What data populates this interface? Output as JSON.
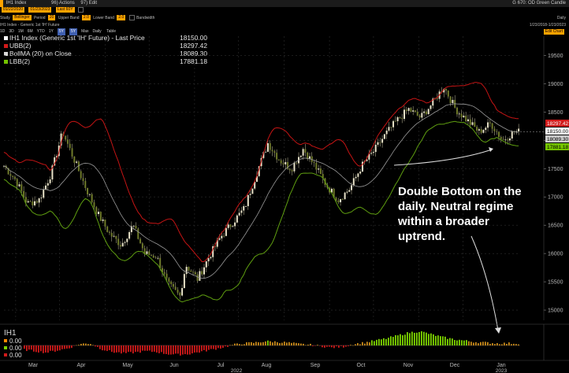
{
  "titlebar": {
    "left": "IH1 Index",
    "menu_actions": "96) Actions",
    "menu_edit": "97) Edit",
    "right": "G 670: OD Green Candle"
  },
  "toolbar": {
    "date_start": "01/22/2020",
    "date_end": "01/23/2023",
    "period": "Last 60Y",
    "study_label": "Study",
    "study_value": "Bollinger",
    "period_label": "Period",
    "period_value": "20",
    "upper_label": "Upper Band",
    "upper_value": "2.0",
    "lower_label": "Lower Band",
    "lower_value": "2.0",
    "bandwidth_label": "Bandwidth",
    "right_daily": "Daily",
    "right_range": "1/23/2018-1/23/2023",
    "security_line": "IH1 Index - Generic 1st 'IH' Future",
    "ranges": [
      "1D",
      "3D",
      "1M",
      "6M",
      "YTD",
      "1Y",
      "5Y",
      "Max",
      "Daily"
    ],
    "selected_range": "5Y",
    "table_label": "Table",
    "right_buttons": "Edit Chart"
  },
  "legend": [
    {
      "label": "IH1 Index (Generic 1st 'IH' Future) - Last Price",
      "value": "18150.00",
      "color": "#ffffff"
    },
    {
      "label": "UBB(2)",
      "value": "18297.42",
      "color": "#d11a1a"
    },
    {
      "label": "BollMA (20)  on Close",
      "value": "18089.30",
      "color": "#d8d8d8"
    },
    {
      "label": "LBB(2)",
      "value": "17881.18",
      "color": "#74c400"
    }
  ],
  "annotation": [
    "Double Bottom on the",
    "daily. Neutral regime",
    "within a broader",
    "uptrend."
  ],
  "lower_panel": {
    "title": "IH1",
    "values": [
      "0.00",
      "0.00",
      "0.00"
    ]
  },
  "chart_data": {
    "type": "candlestick",
    "y_ticks": [
      15000,
      15500,
      16000,
      16500,
      17000,
      17500,
      18000,
      18500,
      19000,
      19500
    ],
    "ylim": [
      14820,
      19840
    ],
    "x_months": [
      "Mar",
      "Apr",
      "May",
      "Jun",
      "Jul",
      "Aug",
      "Sep",
      "Oct",
      "Nov",
      "Dec",
      "Jan"
    ],
    "x_years": [
      "2022",
      "2023"
    ],
    "price_tags": [
      {
        "value": "18297.42",
        "bg": "#d11a1a",
        "fg": "#ffffff"
      },
      {
        "value": "18150.00",
        "bg": "#ffffff",
        "fg": "#000000"
      },
      {
        "value": "18089.30",
        "bg": "#cccccc",
        "fg": "#000000"
      },
      {
        "value": "17881.18",
        "bg": "#74c400",
        "fg": "#000000"
      }
    ],
    "close_path": [
      [
        0,
        17550
      ],
      [
        8,
        17300
      ],
      [
        16,
        16880
      ],
      [
        24,
        16950
      ],
      [
        32,
        17400
      ],
      [
        40,
        18150
      ],
      [
        48,
        17650
      ],
      [
        56,
        17150
      ],
      [
        64,
        16700
      ],
      [
        72,
        16350
      ],
      [
        80,
        16150
      ],
      [
        88,
        16500
      ],
      [
        96,
        16000
      ],
      [
        104,
        15950
      ],
      [
        112,
        15450
      ],
      [
        120,
        15250
      ],
      [
        124,
        15800
      ],
      [
        132,
        15550
      ],
      [
        140,
        15950
      ],
      [
        148,
        16300
      ],
      [
        156,
        16550
      ],
      [
        164,
        16800
      ],
      [
        172,
        17400
      ],
      [
        180,
        17950
      ],
      [
        188,
        17650
      ],
      [
        196,
        17500
      ],
      [
        204,
        17850
      ],
      [
        212,
        17550
      ],
      [
        220,
        17200
      ],
      [
        228,
        16950
      ],
      [
        236,
        17150
      ],
      [
        244,
        17550
      ],
      [
        252,
        17800
      ],
      [
        260,
        18100
      ],
      [
        268,
        18350
      ],
      [
        276,
        18550
      ],
      [
        284,
        18400
      ],
      [
        292,
        18650
      ],
      [
        300,
        18950
      ],
      [
        308,
        18550
      ],
      [
        316,
        18350
      ],
      [
        324,
        18150
      ],
      [
        332,
        18300
      ],
      [
        340,
        18000
      ],
      [
        348,
        18150
      ],
      [
        352,
        18150
      ]
    ],
    "volume_osc": [
      -0.6,
      -0.8,
      -1.0,
      -0.7,
      -0.4,
      0.2,
      0.3,
      -0.5,
      -0.9,
      -1.1,
      -1.0,
      -0.8,
      -0.9,
      -1.2,
      -1.3,
      -1.2,
      -0.9,
      -0.6,
      -0.3,
      0.1,
      0.3,
      0.4,
      0.6,
      0.5,
      0.4,
      0.2,
      0.1,
      -0.1,
      -0.3,
      -0.2,
      0.2,
      0.4,
      0.7,
      1.0,
      1.4,
      1.8,
      2.0,
      1.6,
      1.2,
      0.9,
      0.7,
      0.5,
      0.4,
      0.3,
      0.3,
      0.3
    ]
  }
}
